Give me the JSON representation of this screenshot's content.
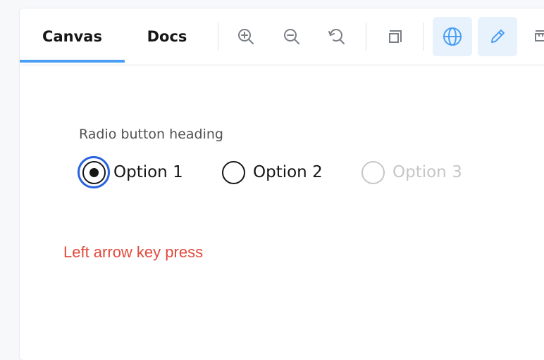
{
  "tabs": {
    "canvas": "Canvas",
    "docs": "Docs"
  },
  "toolbar": {
    "icons": [
      "zoom-in-icon",
      "zoom-out-icon",
      "reset-zoom-icon",
      "layers-icon",
      "globe-icon",
      "pencil-icon",
      "ruler-icon"
    ],
    "active_tab": "Canvas",
    "accent_color": "#4a9ff5"
  },
  "radio_group": {
    "heading": "Radio button heading",
    "options": [
      {
        "label": "Option 1",
        "selected": true,
        "disabled": false,
        "focused": true
      },
      {
        "label": "Option 2",
        "selected": false,
        "disabled": false
      },
      {
        "label": "Option 3",
        "selected": false,
        "disabled": true
      }
    ],
    "focus_color": "#2a62e0"
  },
  "note": {
    "text": "Left arrow key press",
    "color": "#e14a3c"
  }
}
